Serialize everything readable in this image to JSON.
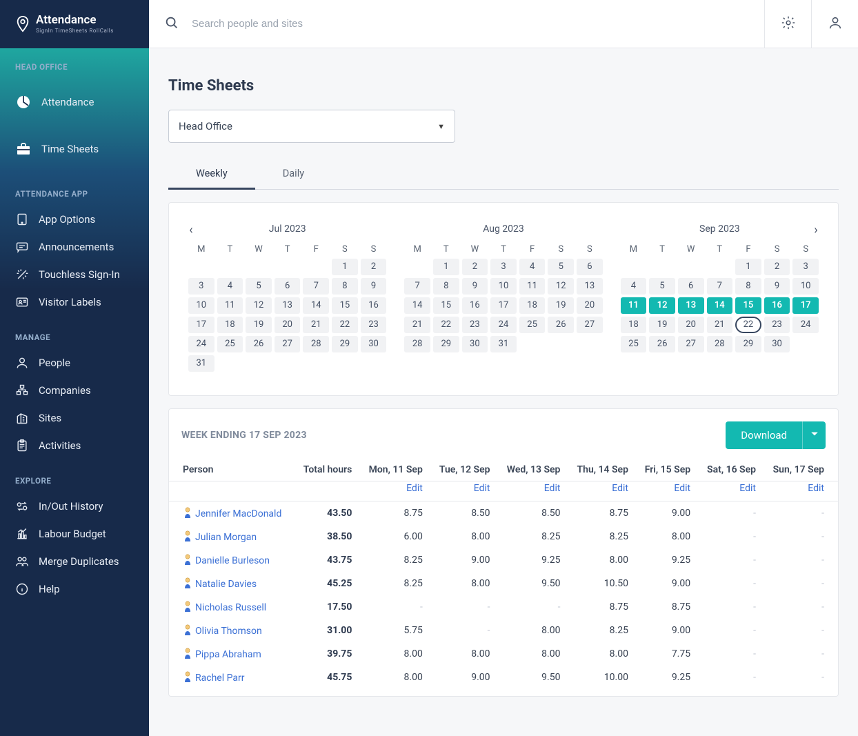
{
  "brand": {
    "name": "Attendance",
    "subtitle": "SignIn  TimeSheets  RollCalls"
  },
  "search": {
    "placeholder": "Search people and sites"
  },
  "sidebar": {
    "sections": [
      {
        "label": "HEAD OFFICE",
        "items": [
          {
            "id": "attendance",
            "label": "Attendance",
            "icon": "pie"
          },
          {
            "id": "timesheets",
            "label": "Time Sheets",
            "icon": "briefcase"
          }
        ]
      },
      {
        "label": "ATTENDANCE APP",
        "items": [
          {
            "id": "appoptions",
            "label": "App Options",
            "icon": "tablet"
          },
          {
            "id": "announcements",
            "label": "Announcements",
            "icon": "chat"
          },
          {
            "id": "touchless",
            "label": "Touchless Sign-In",
            "icon": "wand"
          },
          {
            "id": "visitorlabels",
            "label": "Visitor Labels",
            "icon": "idcard"
          }
        ]
      },
      {
        "label": "MANAGE",
        "items": [
          {
            "id": "people",
            "label": "People",
            "icon": "person"
          },
          {
            "id": "companies",
            "label": "Companies",
            "icon": "org"
          },
          {
            "id": "sites",
            "label": "Sites",
            "icon": "building"
          },
          {
            "id": "activities",
            "label": "Activities",
            "icon": "clipboard"
          }
        ]
      },
      {
        "label": "EXPLORE",
        "items": [
          {
            "id": "inout",
            "label": "In/Out History",
            "icon": "swap"
          },
          {
            "id": "budget",
            "label": "Labour Budget",
            "icon": "barchart"
          },
          {
            "id": "merge",
            "label": "Merge Duplicates",
            "icon": "twopeople"
          },
          {
            "id": "help",
            "label": "Help",
            "icon": "info"
          }
        ]
      }
    ]
  },
  "page": {
    "title": "Time Sheets",
    "siteSelected": "Head Office",
    "tabs": {
      "weekly": "Weekly",
      "daily": "Daily",
      "active": "weekly"
    }
  },
  "calendar": {
    "dow": [
      "M",
      "T",
      "W",
      "T",
      "F",
      "S",
      "S"
    ],
    "months": [
      {
        "name": "Jul 2023",
        "lead": 5,
        "days": 31
      },
      {
        "name": "Aug 2023",
        "lead": 1,
        "days": 31
      },
      {
        "name": "Sep 2023",
        "lead": 4,
        "days": 30,
        "highlight": [
          11,
          12,
          13,
          14,
          15,
          16,
          17
        ],
        "today": 22
      }
    ]
  },
  "timesheet": {
    "weekLabel": "WEEK ENDING 17 SEP 2023",
    "download": "Download",
    "edit": "Edit",
    "columns": [
      "Person",
      "Total hours",
      "Mon, 11 Sep",
      "Tue, 12 Sep",
      "Wed, 13 Sep",
      "Thu, 14 Sep",
      "Fri, 15 Sep",
      "Sat, 16 Sep",
      "Sun, 17 Sep"
    ],
    "rows": [
      {
        "name": "Jennifer MacDonald",
        "total": "43.50",
        "d": [
          "8.75",
          "8.50",
          "8.50",
          "8.75",
          "9.00",
          "-",
          "-"
        ]
      },
      {
        "name": "Julian Morgan",
        "total": "38.50",
        "d": [
          "6.00",
          "8.00",
          "8.25",
          "8.25",
          "8.00",
          "-",
          "-"
        ]
      },
      {
        "name": "Danielle Burleson",
        "total": "43.75",
        "d": [
          "8.25",
          "9.00",
          "9.25",
          "8.00",
          "9.25",
          "-",
          "-"
        ]
      },
      {
        "name": "Natalie Davies",
        "total": "45.25",
        "d": [
          "8.25",
          "8.00",
          "9.50",
          "10.50",
          "9.00",
          "-",
          "-"
        ]
      },
      {
        "name": "Nicholas Russell",
        "total": "17.50",
        "d": [
          "-",
          "-",
          "-",
          "8.75",
          "8.75",
          "-",
          "-"
        ]
      },
      {
        "name": "Olivia Thomson",
        "total": "31.00",
        "d": [
          "5.75",
          "-",
          "8.00",
          "8.25",
          "9.00",
          "-",
          "-"
        ]
      },
      {
        "name": "Pippa Abraham",
        "total": "39.75",
        "d": [
          "8.00",
          "8.00",
          "8.00",
          "8.00",
          "7.75",
          "-",
          "-"
        ]
      },
      {
        "name": "Rachel Parr",
        "total": "45.75",
        "d": [
          "8.00",
          "9.00",
          "9.50",
          "10.00",
          "9.25",
          "-",
          "-"
        ]
      }
    ]
  }
}
